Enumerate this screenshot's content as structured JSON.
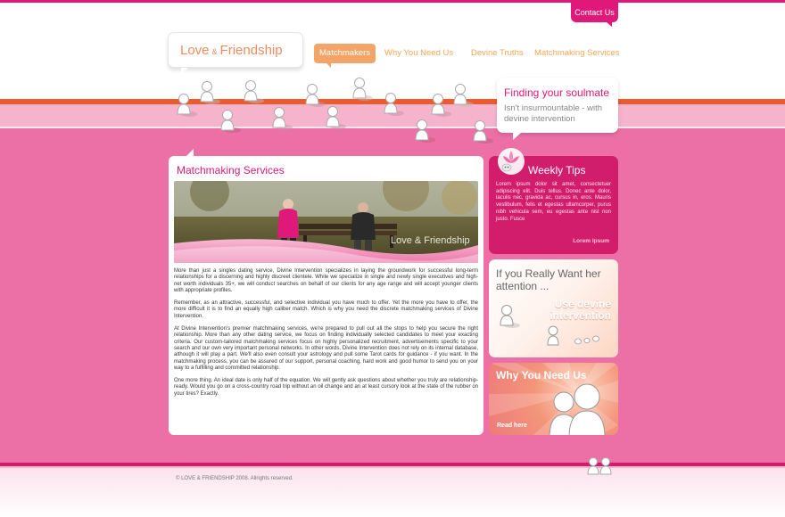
{
  "header": {
    "contact_label": "Contact Us",
    "logo": {
      "part1": "Love",
      "amp": "&",
      "part2": "Friendship"
    }
  },
  "nav": {
    "items": [
      {
        "label": "Matchmakers",
        "active": true
      },
      {
        "label": "Why You Need Us",
        "active": false
      },
      {
        "label": "Devine Truths",
        "active": false
      },
      {
        "label": "Matchmaking Services",
        "active": false
      }
    ]
  },
  "tagline": {
    "title": "Finding your soulmate",
    "subtitle": "Isn't insurmountable - with devine intervention"
  },
  "main": {
    "title": "Matchmaking Services",
    "hero_watermark": "Love & Friendship",
    "paragraphs": [
      "More than just a singles dating service, Divine Intervention specializes in laying the groundwork for successful long-term relationships for a discerning and highly discreet clientele. While we specialize in single and newly single executives and high-net worth individuals 35+, we will conduct searches on behalf of our clients for any age range and will accept younger clients with appropriate profiles.",
      "Remember, as an attractive, successful, and selective individual you have much to offer. Yet the more you have to offer, the more difficult it is to find an equally high caliber match. Which is why you need the discrete matchmaking services of Divine Intervention.",
      "At Divine Intervention's premier matchmaking services, we're prepared to pull out all the stops to help you secure the right relationship. More than any other dating service, we focus on finding individually selected candidates to meet your exacting criteria. Our custom-tailored matchmaking services focus on highly personalized recruitment, advertisements specific to your search and our own very important personal networks. In other words, Divine Intervention does not rely on its internal database, although it will play a part. We'll also even consult your astrology and pull some Tarot cards for guidance - if you want. In the matchmaking process, you can be assured of our support, personal coaching, hard work and good humor to send you on your way to a fulfilling and committed relationship.",
      "One more thing. An ideal date is only half of the equation. We will gently ask questions about whether you truly are relationship-ready. Would you go on a cross-country road trip without an oil change and an at least cursory look at the state of the rubber on your tires? Exactly."
    ]
  },
  "sidebar": {
    "tips": {
      "title": "Weekly Tips",
      "body": "Lorem ipsum dolor sit amet, consectetuer adipiscing elit. Duis tellus. Donec ante dolor, iaculis nec, gravida ac, cursus in, eros. Mauris vestibulum, felis et egestas ullamcorper, purus nibh vehicula sem, eu egestas ante nisl non justo. Fusce",
      "link": "Lorem Ipsum"
    },
    "attention": {
      "title": "If you Really Want her attention ...",
      "cta_line1": "Use devine",
      "cta_line2": "intervention"
    },
    "why": {
      "title": "Why You Need Us",
      "link": "Read here"
    }
  },
  "footer": {
    "copyright": "© LOVE & FRIENDSHIP 2008. Allrights reserved."
  },
  "colors": {
    "brand_pink": "#e0187a",
    "background_pink": "#ec6fa6",
    "tips_pink": "#d21d6c",
    "orange_stripe": "#ee5a2b",
    "nav_orange": "#f5a855"
  }
}
